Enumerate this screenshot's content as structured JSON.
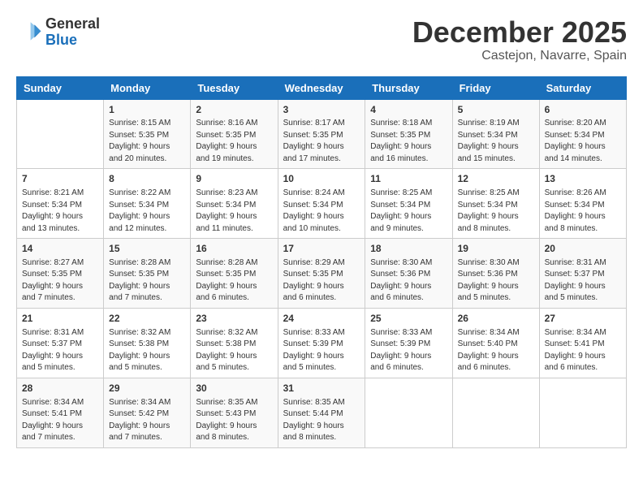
{
  "header": {
    "logo": {
      "line1": "General",
      "line2": "Blue"
    },
    "title": "December 2025",
    "location": "Castejon, Navarre, Spain"
  },
  "calendar": {
    "days_of_week": [
      "Sunday",
      "Monday",
      "Tuesday",
      "Wednesday",
      "Thursday",
      "Friday",
      "Saturday"
    ],
    "weeks": [
      [
        {
          "day": "",
          "info": ""
        },
        {
          "day": "1",
          "info": "Sunrise: 8:15 AM\nSunset: 5:35 PM\nDaylight: 9 hours\nand 20 minutes."
        },
        {
          "day": "2",
          "info": "Sunrise: 8:16 AM\nSunset: 5:35 PM\nDaylight: 9 hours\nand 19 minutes."
        },
        {
          "day": "3",
          "info": "Sunrise: 8:17 AM\nSunset: 5:35 PM\nDaylight: 9 hours\nand 17 minutes."
        },
        {
          "day": "4",
          "info": "Sunrise: 8:18 AM\nSunset: 5:35 PM\nDaylight: 9 hours\nand 16 minutes."
        },
        {
          "day": "5",
          "info": "Sunrise: 8:19 AM\nSunset: 5:34 PM\nDaylight: 9 hours\nand 15 minutes."
        },
        {
          "day": "6",
          "info": "Sunrise: 8:20 AM\nSunset: 5:34 PM\nDaylight: 9 hours\nand 14 minutes."
        }
      ],
      [
        {
          "day": "7",
          "info": "Sunrise: 8:21 AM\nSunset: 5:34 PM\nDaylight: 9 hours\nand 13 minutes."
        },
        {
          "day": "8",
          "info": "Sunrise: 8:22 AM\nSunset: 5:34 PM\nDaylight: 9 hours\nand 12 minutes."
        },
        {
          "day": "9",
          "info": "Sunrise: 8:23 AM\nSunset: 5:34 PM\nDaylight: 9 hours\nand 11 minutes."
        },
        {
          "day": "10",
          "info": "Sunrise: 8:24 AM\nSunset: 5:34 PM\nDaylight: 9 hours\nand 10 minutes."
        },
        {
          "day": "11",
          "info": "Sunrise: 8:25 AM\nSunset: 5:34 PM\nDaylight: 9 hours\nand 9 minutes."
        },
        {
          "day": "12",
          "info": "Sunrise: 8:25 AM\nSunset: 5:34 PM\nDaylight: 9 hours\nand 8 minutes."
        },
        {
          "day": "13",
          "info": "Sunrise: 8:26 AM\nSunset: 5:34 PM\nDaylight: 9 hours\nand 8 minutes."
        }
      ],
      [
        {
          "day": "14",
          "info": "Sunrise: 8:27 AM\nSunset: 5:35 PM\nDaylight: 9 hours\nand 7 minutes."
        },
        {
          "day": "15",
          "info": "Sunrise: 8:28 AM\nSunset: 5:35 PM\nDaylight: 9 hours\nand 7 minutes."
        },
        {
          "day": "16",
          "info": "Sunrise: 8:28 AM\nSunset: 5:35 PM\nDaylight: 9 hours\nand 6 minutes."
        },
        {
          "day": "17",
          "info": "Sunrise: 8:29 AM\nSunset: 5:35 PM\nDaylight: 9 hours\nand 6 minutes."
        },
        {
          "day": "18",
          "info": "Sunrise: 8:30 AM\nSunset: 5:36 PM\nDaylight: 9 hours\nand 6 minutes."
        },
        {
          "day": "19",
          "info": "Sunrise: 8:30 AM\nSunset: 5:36 PM\nDaylight: 9 hours\nand 5 minutes."
        },
        {
          "day": "20",
          "info": "Sunrise: 8:31 AM\nSunset: 5:37 PM\nDaylight: 9 hours\nand 5 minutes."
        }
      ],
      [
        {
          "day": "21",
          "info": "Sunrise: 8:31 AM\nSunset: 5:37 PM\nDaylight: 9 hours\nand 5 minutes."
        },
        {
          "day": "22",
          "info": "Sunrise: 8:32 AM\nSunset: 5:38 PM\nDaylight: 9 hours\nand 5 minutes."
        },
        {
          "day": "23",
          "info": "Sunrise: 8:32 AM\nSunset: 5:38 PM\nDaylight: 9 hours\nand 5 minutes."
        },
        {
          "day": "24",
          "info": "Sunrise: 8:33 AM\nSunset: 5:39 PM\nDaylight: 9 hours\nand 5 minutes."
        },
        {
          "day": "25",
          "info": "Sunrise: 8:33 AM\nSunset: 5:39 PM\nDaylight: 9 hours\nand 6 minutes."
        },
        {
          "day": "26",
          "info": "Sunrise: 8:34 AM\nSunset: 5:40 PM\nDaylight: 9 hours\nand 6 minutes."
        },
        {
          "day": "27",
          "info": "Sunrise: 8:34 AM\nSunset: 5:41 PM\nDaylight: 9 hours\nand 6 minutes."
        }
      ],
      [
        {
          "day": "28",
          "info": "Sunrise: 8:34 AM\nSunset: 5:41 PM\nDaylight: 9 hours\nand 7 minutes."
        },
        {
          "day": "29",
          "info": "Sunrise: 8:34 AM\nSunset: 5:42 PM\nDaylight: 9 hours\nand 7 minutes."
        },
        {
          "day": "30",
          "info": "Sunrise: 8:35 AM\nSunset: 5:43 PM\nDaylight: 9 hours\nand 8 minutes."
        },
        {
          "day": "31",
          "info": "Sunrise: 8:35 AM\nSunset: 5:44 PM\nDaylight: 9 hours\nand 8 minutes."
        },
        {
          "day": "",
          "info": ""
        },
        {
          "day": "",
          "info": ""
        },
        {
          "day": "",
          "info": ""
        }
      ]
    ]
  }
}
